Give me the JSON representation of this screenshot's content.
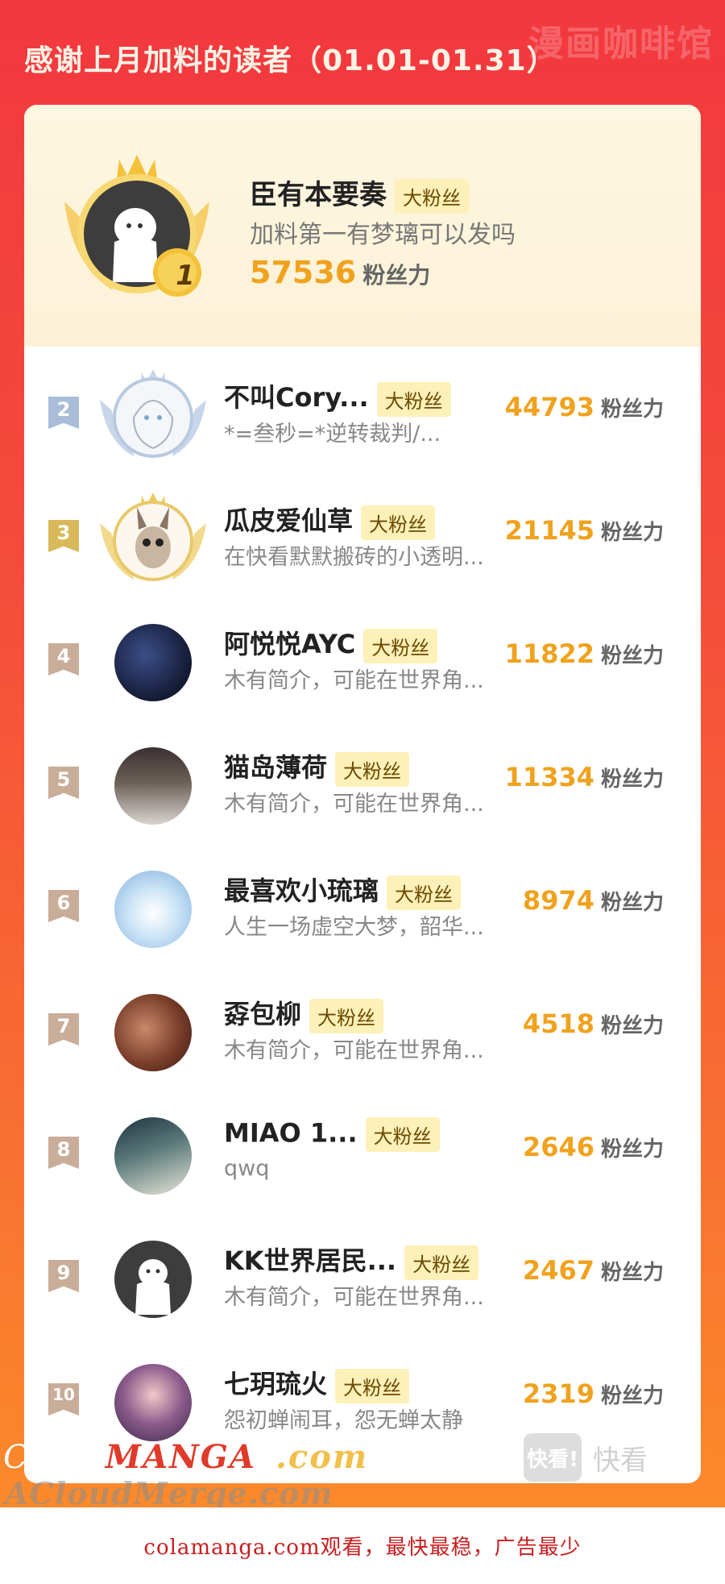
{
  "header": {
    "title": "感谢上月加料的读者（01.01-01.31）",
    "watermark": "漫画咖啡馆"
  },
  "top1": {
    "rank": "1",
    "name": "臣有本要奏",
    "badge": "大粉丝",
    "desc": "加料第一有梦璃可以发吗",
    "score": "57536",
    "unit": "粉丝力"
  },
  "rows": [
    {
      "rank": "2",
      "name": "不叫Cory...",
      "badge": "大粉丝",
      "desc": "*=叁秒=*逆转裁判/...",
      "score": "44793",
      "unit": "粉丝力"
    },
    {
      "rank": "3",
      "name": "瓜皮爱仙草",
      "badge": "大粉丝",
      "desc": "在快看默默搬砖的小透明...",
      "score": "21145",
      "unit": "粉丝力"
    },
    {
      "rank": "4",
      "name": "阿悦悦AYC",
      "badge": "大粉丝",
      "desc": "木有简介，可能在世界角...",
      "score": "11822",
      "unit": "粉丝力"
    },
    {
      "rank": "5",
      "name": "猫岛薄荷",
      "badge": "大粉丝",
      "desc": "木有简介，可能在世界角...",
      "score": "11334",
      "unit": "粉丝力"
    },
    {
      "rank": "6",
      "name": "最喜欢小琉璃",
      "badge": "大粉丝",
      "desc": "人生一场虚空大梦，韶华...",
      "score": "8974",
      "unit": "粉丝力"
    },
    {
      "rank": "7",
      "name": "孬包柳",
      "badge": "大粉丝",
      "desc": "木有简介，可能在世界角...",
      "score": "4518",
      "unit": "粉丝力"
    },
    {
      "rank": "8",
      "name": "MIAO 1...",
      "badge": "大粉丝",
      "desc": "qwq",
      "score": "2646",
      "unit": "粉丝力"
    },
    {
      "rank": "9",
      "name": "KK世界居民...",
      "badge": "大粉丝",
      "desc": "木有简介，可能在世界角...",
      "score": "2467",
      "unit": "粉丝力"
    },
    {
      "rank": "10",
      "name": "七玥琉火",
      "badge": "大粉丝",
      "desc": "怨初蝉闹耳，怨无蝉太静",
      "score": "2319",
      "unit": "粉丝力"
    }
  ],
  "watermarks": {
    "colamanga_prefix": "COLA",
    "colamanga_mid": "MANGA",
    "colamanga_suffix": ".com",
    "acloud": "ACloudMerge.com",
    "kk_box": "快看!",
    "kk_text": "快看"
  },
  "footer": {
    "text": "colamanga.com观看，最快最稳，广告最少"
  },
  "colors": {
    "accent_score": "#f0a21e",
    "flag_silver": "#a9bdd8",
    "flag_gold": "#d9b95a",
    "flag_bronze": "#c9ad98",
    "footer_text": "#c81e1e"
  }
}
